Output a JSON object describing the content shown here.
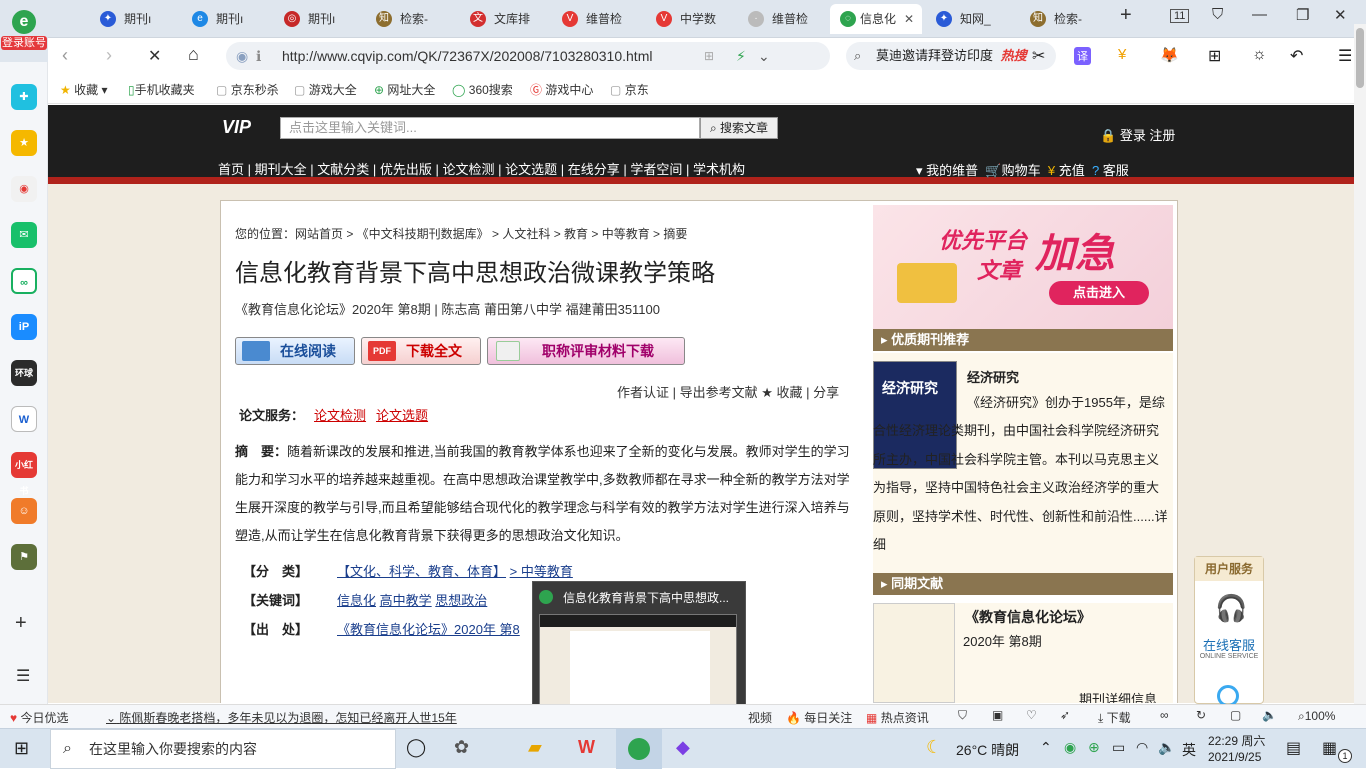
{
  "browser": {
    "login_label": "登录账号",
    "tabs": [
      {
        "label": "期刊ı",
        "color": "#2a5bd7"
      },
      {
        "label": "期刊ı",
        "color": "#1e88e5"
      },
      {
        "label": "期刊ı",
        "color": "#c62828"
      },
      {
        "label": "检索-",
        "color": "#8d6e2f"
      },
      {
        "label": "文库排",
        "color": "#d32f2f"
      },
      {
        "label": "维普检",
        "color": "#e53935"
      },
      {
        "label": "中学数",
        "color": "#e53935"
      },
      {
        "label": "维普检",
        "color": "#999999"
      },
      {
        "label": "信息化",
        "color": "#2ea44f"
      },
      {
        "label": "知网_",
        "color": "#2a5bd7"
      },
      {
        "label": "检索-",
        "color": "#8d6e2f"
      }
    ],
    "tab_count": "11",
    "url": "http://www.cqvip.com/QK/72367X/202008/7103280310.html",
    "search_suggestion": "莫迪邀请拜登访印度",
    "hot_label": "热搜"
  },
  "bookmarks": [
    "收藏",
    "手机收藏夹",
    "京东秒杀",
    "游戏大全",
    "网址大全",
    "360搜索",
    "游戏中心",
    "京东"
  ],
  "sidebar_icons": [
    "add-app-icon",
    "favorites-icon",
    "weibo-icon",
    "mail-icon",
    "link-icon",
    "pdf-icon",
    "game-icon",
    "word-icon",
    "xiaohongshu-icon",
    "game2-icon",
    "pubg-icon"
  ],
  "site": {
    "logo": "VIP",
    "search_placeholder": "点击这里输入关键词...",
    "search_button": "搜索文章",
    "login": "登录 注册",
    "menu": [
      "首页",
      "期刊大全",
      "文献分类",
      "优先出版",
      "论文检测",
      "论文选题",
      "在线分享",
      "学者空间",
      "学术机构"
    ],
    "right_menu": [
      "我的维普",
      "购物车",
      "充值",
      "客服"
    ]
  },
  "article": {
    "breadcrumb": "您的位置：网站首页 > 《中文科技期刊数据库》 > 人文社科 > 教育 > 中等教育 > 摘要",
    "title": "信息化教育背景下高中思想政治微课教学策略",
    "meta": "《教育信息化论坛》2020年 第8期 | 陈志高   莆田第八中学 福建莆田351100",
    "btn_read": "在线阅读",
    "btn_download": "下载全文",
    "btn_title": "职称评审材料下载",
    "tools": "作者认证 | 导出参考文献 ★ 收藏 | 分享",
    "service_label": "论文服务：",
    "service_links": [
      "论文检测",
      "论文选题"
    ],
    "abstract_label": "摘　要：",
    "abstract": "随着新课改的发展和推进,当前我国的教育教学体系也迎来了全新的变化与发展。教师对学生的学习能力和学习水平的培养越来越重视。在高中思想政治课堂教学中,多数教师都在寻求一种全新的教学方法对学生展开深度的教学与引导,而且希望能够结合现代化的教学理念与科学有效的教学方法对学生进行深入培养与塑造,从而让学生在信息化教育背景下获得更多的思想政治文化知识。",
    "class_label": "【分　类】",
    "class_value": "【文化、科学、教育、体育】",
    "class_value2": "> 中等教育",
    "kw_label": "【关键词】",
    "keywords": [
      "信息化",
      "高中教学",
      "思想政治"
    ],
    "src_label": "【出　处】",
    "src_value": "《教育信息化论坛》2020年 第8"
  },
  "right": {
    "ad_line1": "优先平台",
    "ad_line2": "文章",
    "ad_big": "加急",
    "ad_btn": "点击进入",
    "rec_head": "优质期刊推荐",
    "rec_name": "经济研究",
    "rec_desc": "《经济研究》创办于1955年，是综合性经济理论类期刊，由中国社会科学院经济研究所主办，中国社会科学院主管。本刊以马克思主义为指导，坚持中国特色社会主义政治经济学的重大原则，坚持学术性、时代性、创新性和前沿性......详细",
    "same_head": "同期文献",
    "same_name": "《教育信息化论坛》",
    "same_issue": "2020年 第8期",
    "same_more": "期刊详细信息",
    "service_title": "用户服务",
    "service_online": "在线客服",
    "service_en": "ONLINE SERVICE"
  },
  "preview": {
    "title": "信息化教育背景下高中思想政..."
  },
  "newsbar": {
    "left": "今日优选",
    "headline": "陈佩斯春晚老搭档，多年未见以为退圈，怎知已经离开人世15年",
    "items": [
      "视频",
      "每日关注",
      "热点资讯",
      "下载"
    ],
    "zoom": "100%"
  },
  "taskbar": {
    "search_placeholder": "在这里输入你要搜索的内容",
    "weather": "26°C 晴朗",
    "ime": "英",
    "time": "22:29 周六",
    "date": "2021/9/25",
    "notif_count": "1"
  }
}
